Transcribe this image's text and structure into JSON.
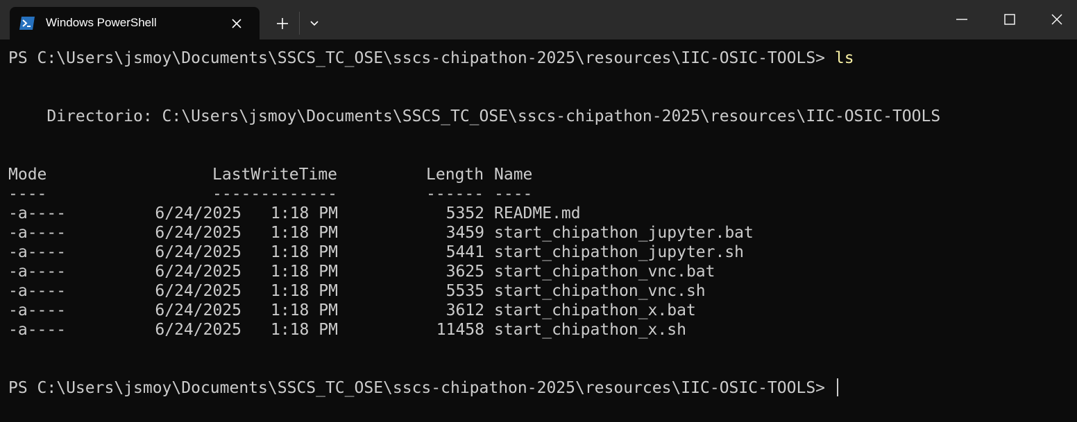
{
  "window": {
    "tab_title": "Windows PowerShell",
    "tab_icon": "powershell-icon",
    "buttons": {
      "close_tab": "close-icon",
      "new_tab": "plus-icon",
      "dropdown": "chevron-down-icon",
      "minimize": "minimize-icon",
      "maximize": "maximize-icon",
      "close_window": "close-icon"
    },
    "colors": {
      "titlebar": "#2b2b2b",
      "background": "#0c0c0c",
      "text": "#cccccc",
      "command": "#f9f1a5"
    }
  },
  "terminal": {
    "prompt1": "PS C:\\Users\\jsmoy\\Documents\\SSCS_TC_OSE\\sscs-chipathon-2025\\resources\\IIC-OSIC-TOOLS> ",
    "command1": "ls",
    "directory_line": "    Directorio: C:\\Users\\jsmoy\\Documents\\SSCS_TC_OSE\\sscs-chipathon-2025\\resources\\IIC-OSIC-TOOLS",
    "headers": {
      "mode": "Mode",
      "lastwritetime": "LastWriteTime",
      "length": "Length",
      "name": "Name"
    },
    "separators": {
      "mode": "----",
      "lastwritetime": "-------------",
      "length": "------",
      "name": "----"
    },
    "rows": [
      {
        "mode": "-a----",
        "date": "6/24/2025",
        "time": "1:18 PM",
        "length": "5352",
        "name": "README.md"
      },
      {
        "mode": "-a----",
        "date": "6/24/2025",
        "time": "1:18 PM",
        "length": "3459",
        "name": "start_chipathon_jupyter.bat"
      },
      {
        "mode": "-a----",
        "date": "6/24/2025",
        "time": "1:18 PM",
        "length": "5441",
        "name": "start_chipathon_jupyter.sh"
      },
      {
        "mode": "-a----",
        "date": "6/24/2025",
        "time": "1:18 PM",
        "length": "3625",
        "name": "start_chipathon_vnc.bat"
      },
      {
        "mode": "-a----",
        "date": "6/24/2025",
        "time": "1:18 PM",
        "length": "5535",
        "name": "start_chipathon_vnc.sh"
      },
      {
        "mode": "-a----",
        "date": "6/24/2025",
        "time": "1:18 PM",
        "length": "3612",
        "name": "start_chipathon_x.bat"
      },
      {
        "mode": "-a----",
        "date": "6/24/2025",
        "time": "1:18 PM",
        "length": "11458",
        "name": "start_chipathon_x.sh"
      }
    ],
    "prompt2": "PS C:\\Users\\jsmoy\\Documents\\SSCS_TC_OSE\\sscs-chipathon-2025\\resources\\IIC-OSIC-TOOLS> "
  }
}
